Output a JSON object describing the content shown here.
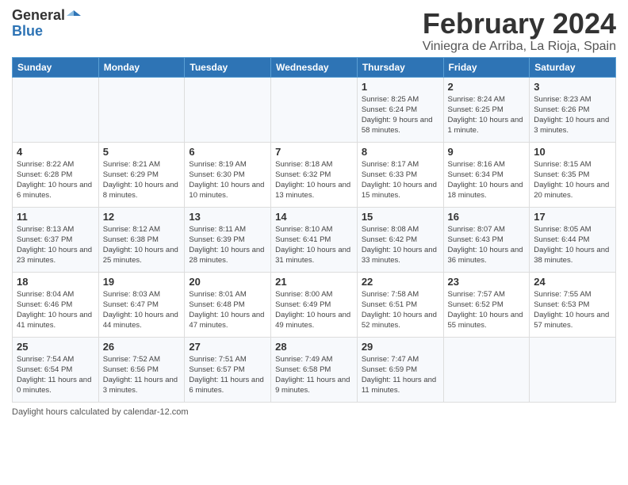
{
  "header": {
    "logo_line1": "General",
    "logo_line2": "Blue",
    "title": "February 2024",
    "subtitle": "Viniegra de Arriba, La Rioja, Spain"
  },
  "days_of_week": [
    "Sunday",
    "Monday",
    "Tuesday",
    "Wednesday",
    "Thursday",
    "Friday",
    "Saturday"
  ],
  "footer_label": "Daylight hours",
  "weeks": [
    [
      {
        "day": "",
        "content": ""
      },
      {
        "day": "",
        "content": ""
      },
      {
        "day": "",
        "content": ""
      },
      {
        "day": "",
        "content": ""
      },
      {
        "day": "1",
        "content": "Sunrise: 8:25 AM\nSunset: 6:24 PM\nDaylight: 9 hours\nand 58 minutes."
      },
      {
        "day": "2",
        "content": "Sunrise: 8:24 AM\nSunset: 6:25 PM\nDaylight: 10 hours\nand 1 minute."
      },
      {
        "day": "3",
        "content": "Sunrise: 8:23 AM\nSunset: 6:26 PM\nDaylight: 10 hours\nand 3 minutes."
      }
    ],
    [
      {
        "day": "4",
        "content": "Sunrise: 8:22 AM\nSunset: 6:28 PM\nDaylight: 10 hours\nand 6 minutes."
      },
      {
        "day": "5",
        "content": "Sunrise: 8:21 AM\nSunset: 6:29 PM\nDaylight: 10 hours\nand 8 minutes."
      },
      {
        "day": "6",
        "content": "Sunrise: 8:19 AM\nSunset: 6:30 PM\nDaylight: 10 hours\nand 10 minutes."
      },
      {
        "day": "7",
        "content": "Sunrise: 8:18 AM\nSunset: 6:32 PM\nDaylight: 10 hours\nand 13 minutes."
      },
      {
        "day": "8",
        "content": "Sunrise: 8:17 AM\nSunset: 6:33 PM\nDaylight: 10 hours\nand 15 minutes."
      },
      {
        "day": "9",
        "content": "Sunrise: 8:16 AM\nSunset: 6:34 PM\nDaylight: 10 hours\nand 18 minutes."
      },
      {
        "day": "10",
        "content": "Sunrise: 8:15 AM\nSunset: 6:35 PM\nDaylight: 10 hours\nand 20 minutes."
      }
    ],
    [
      {
        "day": "11",
        "content": "Sunrise: 8:13 AM\nSunset: 6:37 PM\nDaylight: 10 hours\nand 23 minutes."
      },
      {
        "day": "12",
        "content": "Sunrise: 8:12 AM\nSunset: 6:38 PM\nDaylight: 10 hours\nand 25 minutes."
      },
      {
        "day": "13",
        "content": "Sunrise: 8:11 AM\nSunset: 6:39 PM\nDaylight: 10 hours\nand 28 minutes."
      },
      {
        "day": "14",
        "content": "Sunrise: 8:10 AM\nSunset: 6:41 PM\nDaylight: 10 hours\nand 31 minutes."
      },
      {
        "day": "15",
        "content": "Sunrise: 8:08 AM\nSunset: 6:42 PM\nDaylight: 10 hours\nand 33 minutes."
      },
      {
        "day": "16",
        "content": "Sunrise: 8:07 AM\nSunset: 6:43 PM\nDaylight: 10 hours\nand 36 minutes."
      },
      {
        "day": "17",
        "content": "Sunrise: 8:05 AM\nSunset: 6:44 PM\nDaylight: 10 hours\nand 38 minutes."
      }
    ],
    [
      {
        "day": "18",
        "content": "Sunrise: 8:04 AM\nSunset: 6:46 PM\nDaylight: 10 hours\nand 41 minutes."
      },
      {
        "day": "19",
        "content": "Sunrise: 8:03 AM\nSunset: 6:47 PM\nDaylight: 10 hours\nand 44 minutes."
      },
      {
        "day": "20",
        "content": "Sunrise: 8:01 AM\nSunset: 6:48 PM\nDaylight: 10 hours\nand 47 minutes."
      },
      {
        "day": "21",
        "content": "Sunrise: 8:00 AM\nSunset: 6:49 PM\nDaylight: 10 hours\nand 49 minutes."
      },
      {
        "day": "22",
        "content": "Sunrise: 7:58 AM\nSunset: 6:51 PM\nDaylight: 10 hours\nand 52 minutes."
      },
      {
        "day": "23",
        "content": "Sunrise: 7:57 AM\nSunset: 6:52 PM\nDaylight: 10 hours\nand 55 minutes."
      },
      {
        "day": "24",
        "content": "Sunrise: 7:55 AM\nSunset: 6:53 PM\nDaylight: 10 hours\nand 57 minutes."
      }
    ],
    [
      {
        "day": "25",
        "content": "Sunrise: 7:54 AM\nSunset: 6:54 PM\nDaylight: 11 hours\nand 0 minutes."
      },
      {
        "day": "26",
        "content": "Sunrise: 7:52 AM\nSunset: 6:56 PM\nDaylight: 11 hours\nand 3 minutes."
      },
      {
        "day": "27",
        "content": "Sunrise: 7:51 AM\nSunset: 6:57 PM\nDaylight: 11 hours\nand 6 minutes."
      },
      {
        "day": "28",
        "content": "Sunrise: 7:49 AM\nSunset: 6:58 PM\nDaylight: 11 hours\nand 9 minutes."
      },
      {
        "day": "29",
        "content": "Sunrise: 7:47 AM\nSunset: 6:59 PM\nDaylight: 11 hours\nand 11 minutes."
      },
      {
        "day": "",
        "content": ""
      },
      {
        "day": "",
        "content": ""
      }
    ]
  ]
}
